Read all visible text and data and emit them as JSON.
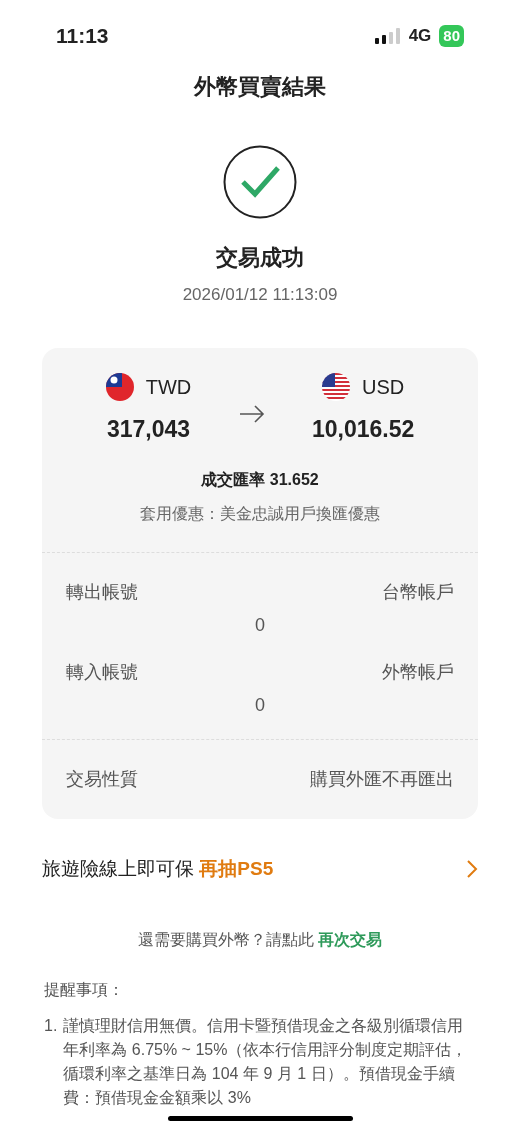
{
  "status_bar": {
    "time": "11:13",
    "network": "4G",
    "battery": "80"
  },
  "header": {
    "title": "外幣買賣結果"
  },
  "result": {
    "title": "交易成功",
    "timestamp": "2026/01/12 11:13:09"
  },
  "exchange": {
    "from": {
      "currency": "TWD",
      "amount": "317,043",
      "kind": "tw"
    },
    "to": {
      "currency": "USD",
      "amount": "10,016.52",
      "kind": "us"
    },
    "rate": "成交匯率 31.652",
    "promo": "套用優惠：美金忠誠用戶換匯優惠"
  },
  "accounts": [
    {
      "label": "轉出帳號",
      "value": "台幣帳戶",
      "number": "0"
    },
    {
      "label": "轉入帳號",
      "value": "外幣帳戶",
      "number": "0"
    }
  ],
  "nature": {
    "label": "交易性質",
    "value": "購買外匯不再匯出"
  },
  "promo_banner": {
    "text": "旅遊險線上即可保",
    "highlight": "再抽PS5"
  },
  "again": {
    "text": "還需要購買外幣？請點此",
    "link": "再次交易"
  },
  "notes": {
    "title": "提醒事項：",
    "items": [
      {
        "marker": "1.",
        "text": "謹慎理財信用無價。信用卡暨預借現金之各級別循環信用年利率為 6.75% ~ 15%（依本行信用評分制度定期評估，循環利率之基準日為 104 年 9 月 1 日）。預借現金手續費：預借現金金額乘以 3%"
      }
    ]
  }
}
